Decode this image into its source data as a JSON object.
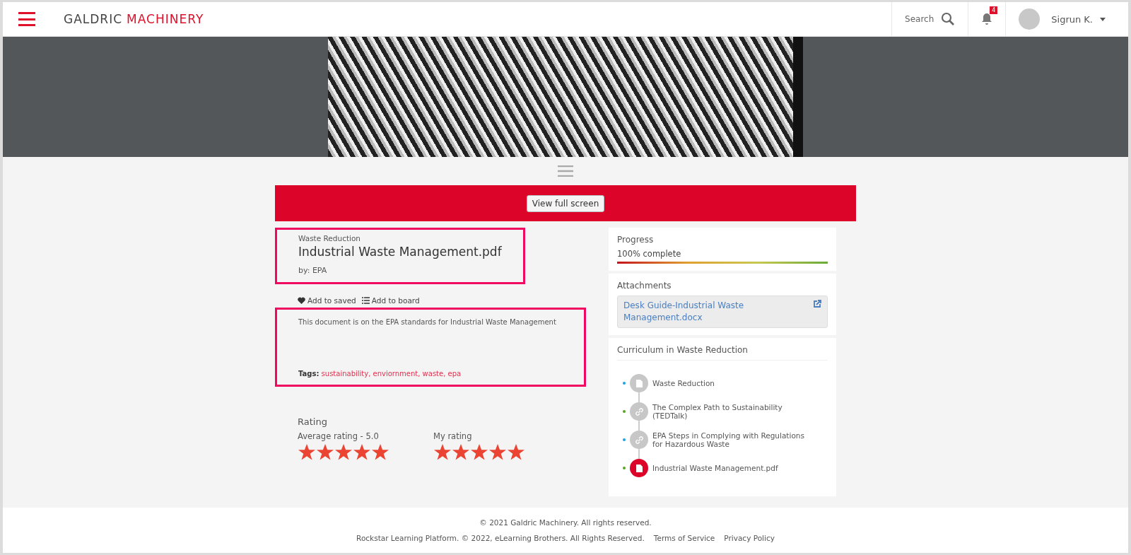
{
  "header": {
    "logo_left": "GALDRIC",
    "logo_right": "MACHINERY",
    "search_label": "Search",
    "notification_count": "4",
    "user_name": "Sigrun K."
  },
  "viewer": {
    "button": "View full screen"
  },
  "item": {
    "category": "Waste Reduction",
    "title": "Industrial Waste Management.pdf",
    "author": "by: EPA",
    "actions": [
      {
        "kind": "heart",
        "label": "Add to saved"
      },
      {
        "kind": "list",
        "label": "Add to board"
      }
    ],
    "description": "This document is on the EPA standards for Industrial Waste Management",
    "tags_label": "Tags:",
    "tags": "sustainability, enviornment, waste, epa"
  },
  "rating": {
    "title": "Rating",
    "groups": [
      {
        "label": "Average rating - 5.0",
        "stars": 5
      },
      {
        "label": "My rating",
        "stars": 5
      }
    ]
  },
  "progress": {
    "title": "Progress",
    "reading": "100% complete",
    "level": 1
  },
  "attachments": {
    "title": "Attachments",
    "files": [
      "Desk Guide-Industrial Waste Management.docx"
    ]
  },
  "curriculum": {
    "title": "Curriculum in Waste Reduction",
    "items": [
      {
        "kind": "document",
        "label": "Waste Reduction",
        "color": "#1aa3e8",
        "selected": false
      },
      {
        "kind": "link",
        "label": "The Complex Path to Sustainability (TEDTalk)",
        "color": "#58a61c",
        "selected": false
      },
      {
        "kind": "link",
        "label": "EPA Steps in Complying with Regulations for Hazardous Waste",
        "color": "#1aa3e8",
        "selected": false
      },
      {
        "kind": "document",
        "label": "Industrial Waste Management.pdf",
        "color": "#58a61c",
        "selected": true
      }
    ]
  },
  "footer": {
    "copyright": "© 2021 Galdric Machinery. All rights reserved.",
    "platform": "Rockstar Learning Platform. © 2022, eLearning Brothers. All Rights Reserved.",
    "links": [
      "Terms of Service",
      "Privacy Policy"
    ]
  }
}
